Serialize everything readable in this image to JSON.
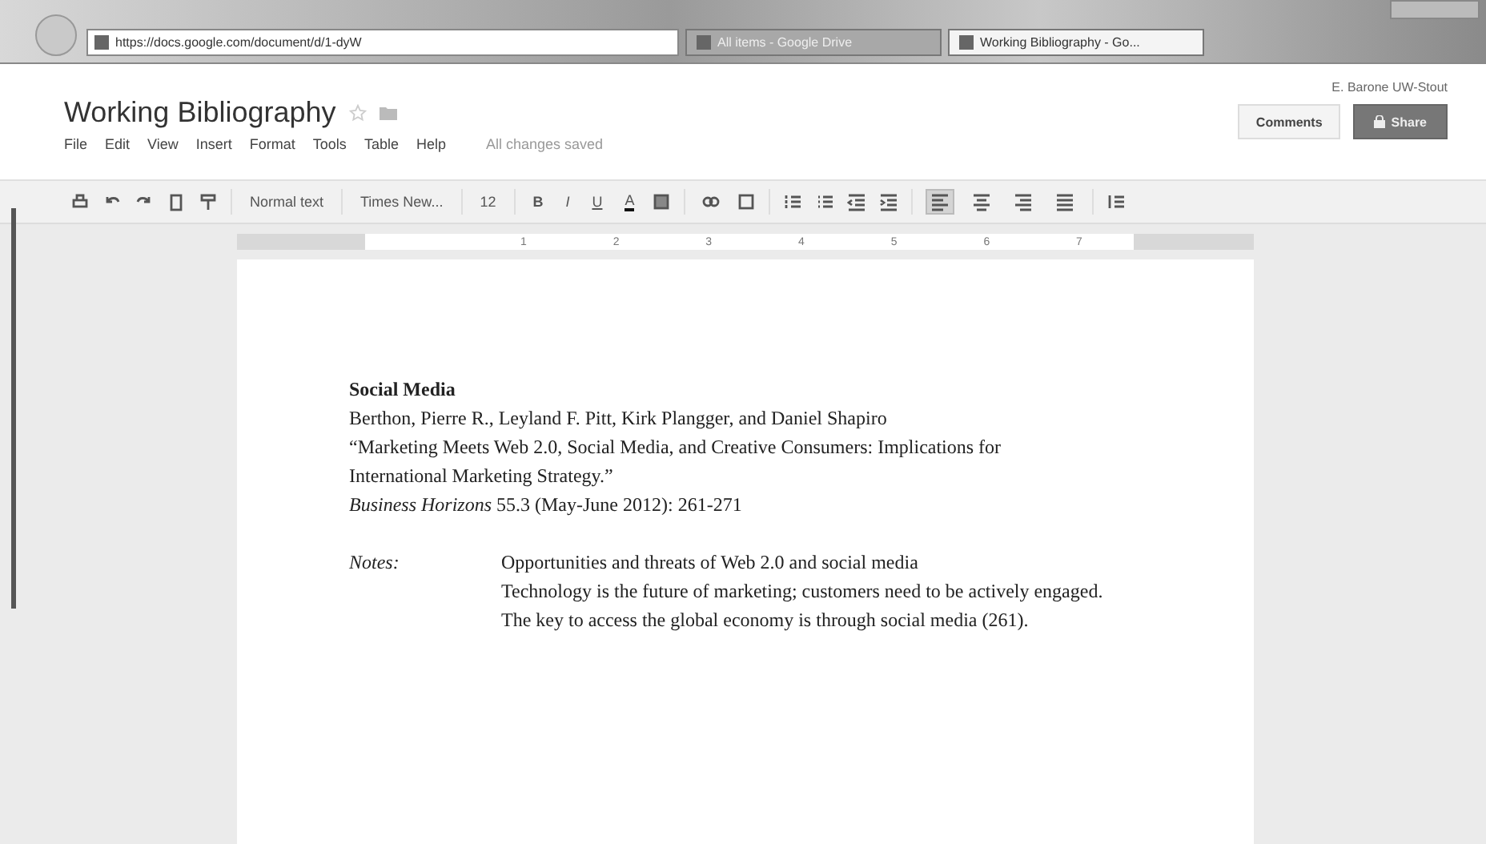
{
  "browser": {
    "url": "https://docs.google.com/document/d/1-dyW",
    "tabs": [
      {
        "label": "All items - Google Drive",
        "selected": false
      },
      {
        "label": "Working Bibliography - Go...",
        "selected": true
      }
    ]
  },
  "document_header": {
    "title": "Working Bibliography",
    "starred": false,
    "user": "E. Barone UW-Stout",
    "comments_button": "Comments",
    "share_button": "Share"
  },
  "menu": [
    "File",
    "Edit",
    "View",
    "Insert",
    "Format",
    "Tools",
    "Table",
    "Help"
  ],
  "save_status": "All changes saved",
  "toolbar": {
    "style": "Normal text",
    "font": "Times New...",
    "size": "12",
    "format_buttons": [
      "B",
      "I",
      "U",
      "A"
    ],
    "alignment": [
      {
        "selected": true
      },
      {
        "selected": false
      },
      {
        "selected": false
      },
      {
        "selected": false
      }
    ]
  },
  "ruler": [
    "1",
    "2",
    "3",
    "4",
    "5",
    "6",
    "7"
  ],
  "document": {
    "heading": "Social Media",
    "lines": [
      {
        "kind": "plain",
        "text": "Berthon, Pierre R., Leyland F. Pitt, Kirk Plangger, and Daniel Shapiro"
      },
      {
        "kind": "plain",
        "text": "“Marketing Meets Web 2.0, Social Media, and Creative Consumers: Implications for"
      },
      {
        "kind": "plain",
        "text": "International Marketing Strategy.”"
      },
      {
        "kind": "plain",
        "text": "*Business Horizons* 55.3 (May-June 2012): 261-271"
      }
    ],
    "notes_label": "Notes:",
    "notes": [
      "Opportunities and threats of Web 2.0 and social media",
      "Technology is the future of marketing; customers need to be actively engaged.",
      "The key to access the global economy is through social media (261)."
    ]
  }
}
